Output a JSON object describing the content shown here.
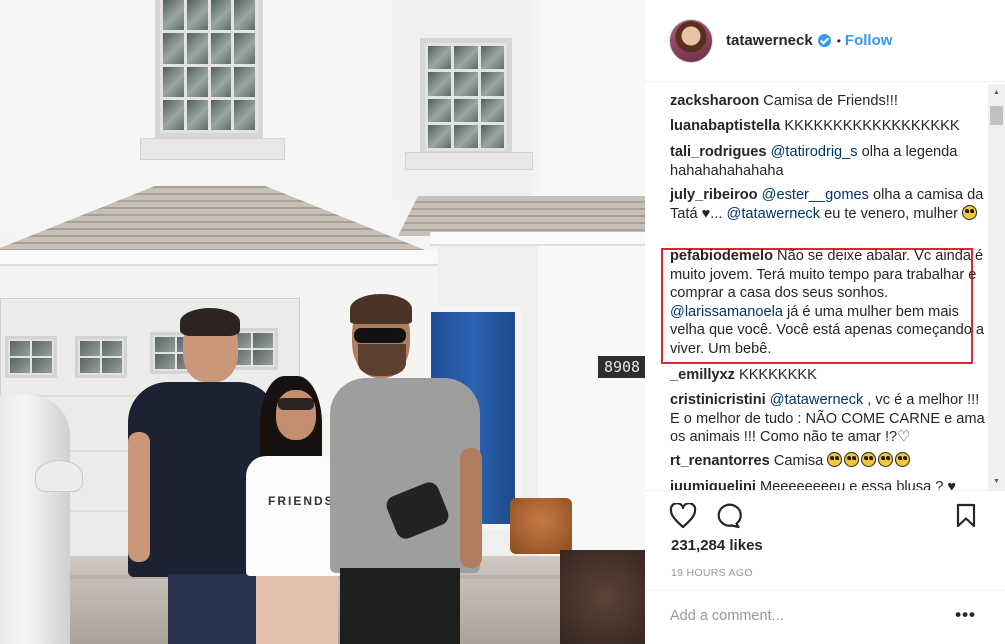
{
  "post": {
    "image_alt": "Three people standing in front of a white house with a garage and a blue door",
    "house_number": "8908"
  },
  "header": {
    "username": "tatawerneck",
    "separator": "•",
    "follow_label": "Follow",
    "verified_icon": "verified-badge-icon"
  },
  "comments": [
    {
      "user": "zacksharoon",
      "parts": [
        {
          "t": " Camisa de Friends!!!"
        }
      ]
    },
    {
      "user": "luanabaptistella",
      "parts": [
        {
          "t": " KKKKKKKKKKKKKKKKKK"
        }
      ]
    },
    {
      "user": "tali_rodrigues",
      "parts": [
        {
          "t": " "
        },
        {
          "m": "@tatirodrig_s"
        },
        {
          "t": " olha a legenda hahahahahahaha"
        }
      ]
    },
    {
      "user": "july_ribeiroo",
      "parts": [
        {
          "t": " "
        },
        {
          "m": "@ester__gomes"
        },
        {
          "t": " olha a camisa da Tatá ♥... "
        },
        {
          "m": "@tatawerneck"
        },
        {
          "t": " eu te venero, mulher "
        },
        {
          "e": "smiling-face-heart-eyes"
        }
      ]
    },
    {
      "user": "pefabiodemelo",
      "highlighted": true,
      "parts": [
        {
          "t": " Não se deixe abalar. Vc ainda é muito jovem. Terá muito tempo para trabalhar e comprar a casa dos seus sonhos. "
        },
        {
          "m": "@larissamanoela"
        },
        {
          "t": " já é uma mulher bem mais velha que você. Você está apenas começando a viver. Um bebê."
        }
      ]
    },
    {
      "user": "_emillyxz",
      "parts": [
        {
          "t": " KKKKKKKK"
        }
      ]
    },
    {
      "user": "cristinicristini",
      "parts": [
        {
          "t": " "
        },
        {
          "m": "@tatawerneck"
        },
        {
          "t": " , vc é a melhor !!! E o melhor de tudo : NÃO COME CARNE e ama os animais !!! Como não te amar !?♡"
        }
      ]
    },
    {
      "user": "rt_renantorres",
      "parts": [
        {
          "t": " Camisa "
        },
        {
          "e": "smiling-face-heart-eyes"
        },
        {
          "e": "smiling-face-heart-eyes"
        },
        {
          "e": "smiling-face-heart-eyes"
        },
        {
          "e": "smiling-face-heart-eyes"
        },
        {
          "e": "smiling-face-heart-eyes"
        }
      ]
    },
    {
      "user": "juumiquelini",
      "parts": [
        {
          "t": " Meeeeeeeeu e essa blusa ? ♥"
        }
      ]
    }
  ],
  "actions": {
    "like_icon": "heart-outline-icon",
    "comment_icon": "comment-bubble-icon",
    "save_icon": "bookmark-outline-icon",
    "likes": "231,284 likes",
    "timestamp": "19 HOURS AGO"
  },
  "add_comment": {
    "placeholder": "Add a comment...",
    "more_label": "•••"
  },
  "colors": {
    "accent": "#3897f0",
    "highlight_border": "#d92b2b",
    "mention": "#003569",
    "text": "#262626",
    "muted": "#999999"
  }
}
